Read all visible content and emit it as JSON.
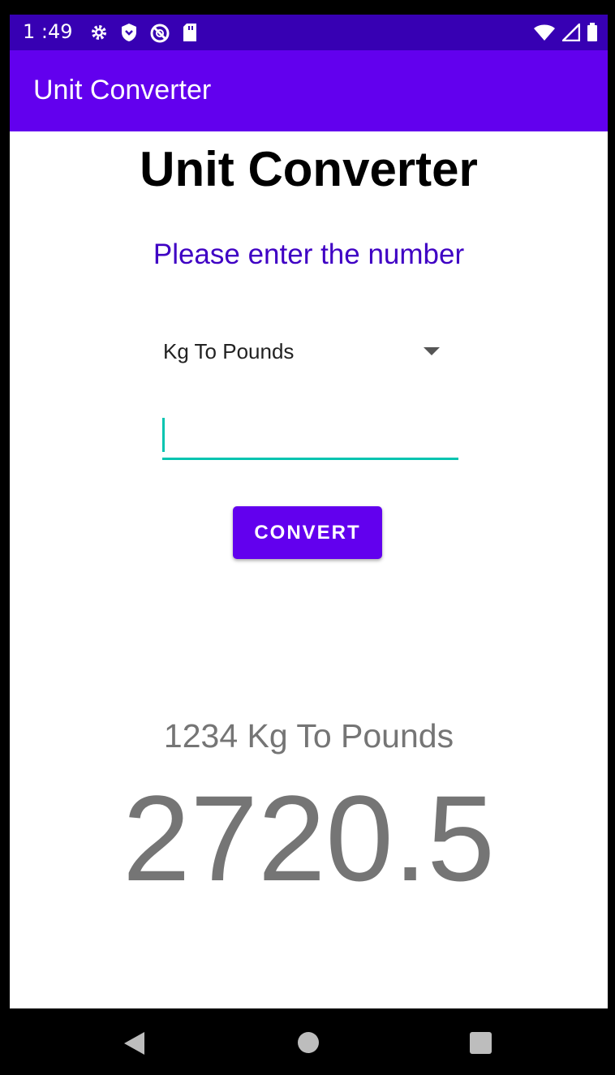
{
  "status_bar": {
    "time": "1 :49",
    "left_icons": [
      "gear-icon",
      "shield-icon",
      "no-data-icon",
      "sd-card-icon"
    ],
    "right_icons": [
      "wifi-icon",
      "signal-icon",
      "battery-icon"
    ]
  },
  "app_bar": {
    "title": "Unit Converter"
  },
  "main": {
    "heading": "Unit Converter",
    "prompt": "Please enter the number",
    "conversion_select": {
      "selected": "Kg To Pounds"
    },
    "number_input": {
      "value": "",
      "placeholder": ""
    },
    "convert_label": "CONVERT",
    "result_label": "1234 Kg To Pounds",
    "result_value": "2720.5"
  },
  "nav_bar": {
    "icons": [
      "back-icon",
      "home-icon",
      "recents-icon"
    ]
  },
  "colors": {
    "status_bar": "#3700b3",
    "app_bar": "#6200ee",
    "prompt_text": "#3f00c4",
    "input_underline": "#03c4b0",
    "button": "#6200ee",
    "result_text": "#757575"
  }
}
